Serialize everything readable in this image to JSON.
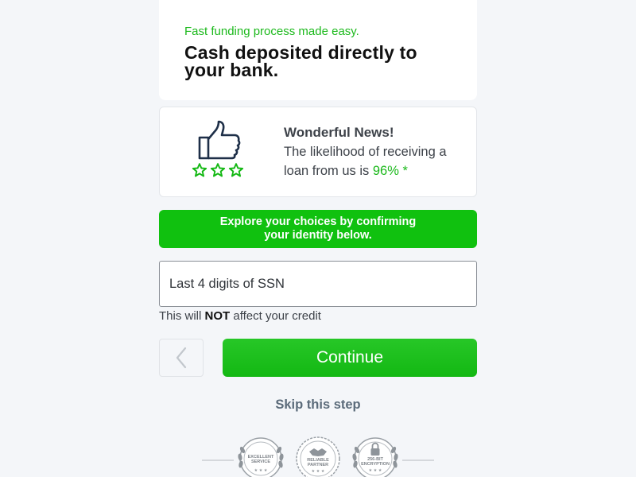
{
  "header": {
    "tagline": "Fast funding process made easy.",
    "headline": "Cash deposited directly to your bank."
  },
  "news": {
    "icon": "thumbs-up-icon",
    "rating_stars": 3,
    "title": "Wonderful News!",
    "body_prefix": "The likelihood of receiving a loan from us is ",
    "percent": "96% *"
  },
  "banner": {
    "text": "Explore your choices by confirming your identity below."
  },
  "ssn": {
    "placeholder": "Last 4 digits of SSN",
    "value": ""
  },
  "note": {
    "prefix": "This will ",
    "emphasis": "NOT",
    "suffix": " affect your credit"
  },
  "actions": {
    "back_icon": "chevron-left-icon",
    "continue_label": "Continue",
    "skip_label": "Skip this step"
  },
  "badges": [
    {
      "line1": "EXCELLENT",
      "line2": "SERVICE",
      "icon": "laurel-wreath-icon"
    },
    {
      "line1": "RELIABLE",
      "line2": "PARTNER",
      "icon": "handshake-icon"
    },
    {
      "line1": "256-BIT",
      "line2": "ENCRYPTION",
      "icon": "lock-icon"
    }
  ],
  "colors": {
    "brand_green": "#10c10f",
    "accent_green_text": "#1cb91c",
    "background": "#f4f6f9",
    "skip_text": "#5b6b7a"
  }
}
